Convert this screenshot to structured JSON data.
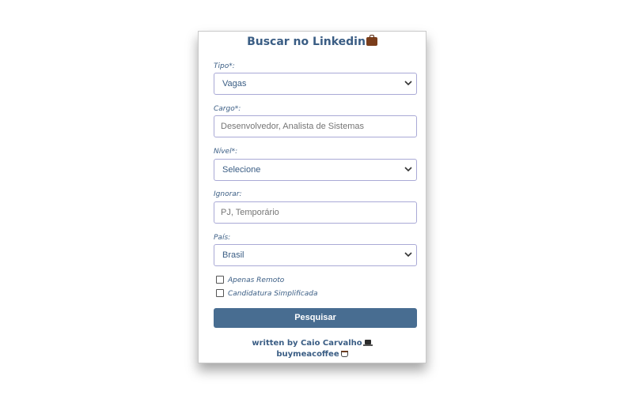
{
  "card": {
    "title": "Buscar no Linkedin",
    "title_icon": "briefcase-icon"
  },
  "form": {
    "tipo": {
      "label": "Tipo*:",
      "value": "Vagas"
    },
    "cargo": {
      "label": "Cargo*:",
      "placeholder": "Desenvolvedor, Analista de Sistemas"
    },
    "nivel": {
      "label": "Nível*:",
      "value": "Selecione"
    },
    "ignorar": {
      "label": "Ignorar:",
      "placeholder": "PJ, Temporário"
    },
    "pais": {
      "label": "País:",
      "value": "Brasil"
    },
    "apenas_remoto": {
      "label": "Apenas Remoto",
      "checked": false
    },
    "candidatura_simplificada": {
      "label": "Candidatura Simplificada",
      "checked": false
    },
    "submit_label": "Pesquisar"
  },
  "footer": {
    "credit": "written by Caio Carvalho",
    "credit_icon": "laptop-icon",
    "coffee": "buymeacoffee",
    "coffee_icon": "coffee-icon"
  },
  "colors": {
    "accent": "#3a5d84",
    "button": "#486d91",
    "field_border": "#a9a9d6"
  }
}
